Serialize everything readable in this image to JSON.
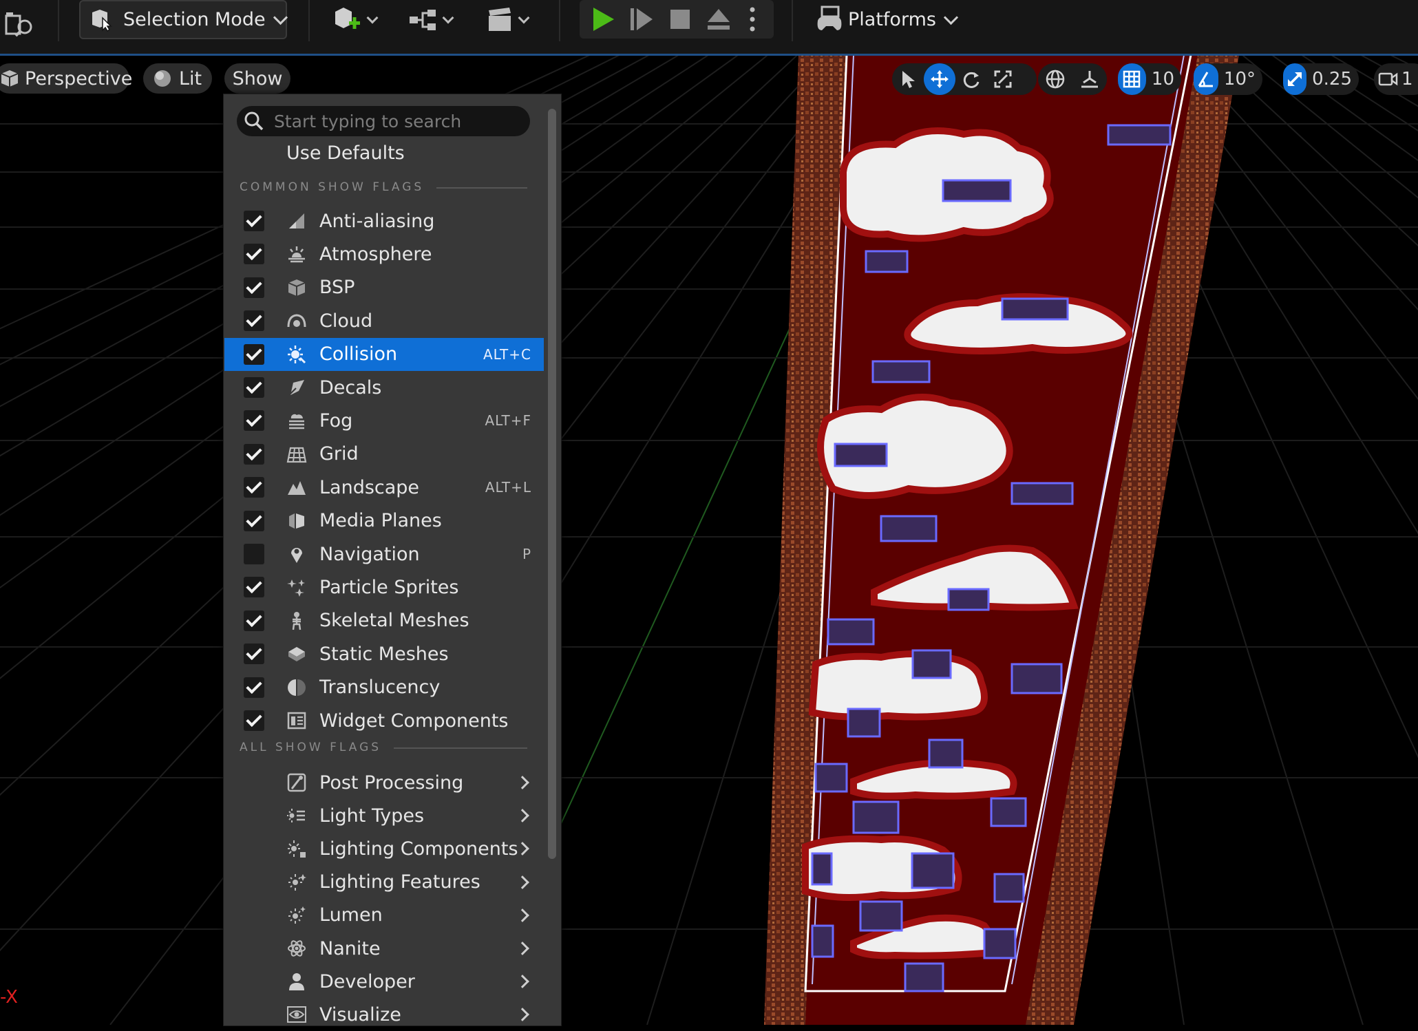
{
  "toolbar": {
    "selection_mode": "Selection Mode",
    "platforms": "Platforms"
  },
  "viewport": {
    "perspective": "Perspective",
    "lit": "Lit",
    "show": "Show",
    "grid_snap": "10",
    "rotation_snap": "10°",
    "scale_snap": "0.25",
    "camera_speed": "1",
    "axis_label": "-X"
  },
  "menu": {
    "search_placeholder": "Start typing to search",
    "use_defaults": "Use Defaults",
    "common_header": "COMMON SHOW FLAGS",
    "all_header": "ALL SHOW FLAGS",
    "common_flags": [
      {
        "label": "Anti-aliasing",
        "checked": true,
        "shortcut": "",
        "icon": "anti-aliasing-icon"
      },
      {
        "label": "Atmosphere",
        "checked": true,
        "shortcut": "",
        "icon": "atmosphere-icon"
      },
      {
        "label": "BSP",
        "checked": true,
        "shortcut": "",
        "icon": "bsp-icon"
      },
      {
        "label": "Cloud",
        "checked": true,
        "shortcut": "",
        "icon": "cloud-icon"
      },
      {
        "label": "Collision",
        "checked": true,
        "shortcut": "ALT+C",
        "icon": "collision-icon",
        "highlighted": true
      },
      {
        "label": "Decals",
        "checked": true,
        "shortcut": "",
        "icon": "decals-icon"
      },
      {
        "label": "Fog",
        "checked": true,
        "shortcut": "ALT+F",
        "icon": "fog-icon"
      },
      {
        "label": "Grid",
        "checked": true,
        "shortcut": "",
        "icon": "grid-icon"
      },
      {
        "label": "Landscape",
        "checked": true,
        "shortcut": "ALT+L",
        "icon": "landscape-icon"
      },
      {
        "label": "Media Planes",
        "checked": true,
        "shortcut": "",
        "icon": "media-planes-icon"
      },
      {
        "label": "Navigation",
        "checked": false,
        "shortcut": "P",
        "icon": "navigation-pin-icon"
      },
      {
        "label": "Particle Sprites",
        "checked": true,
        "shortcut": "",
        "icon": "particle-sprites-icon"
      },
      {
        "label": "Skeletal Meshes",
        "checked": true,
        "shortcut": "",
        "icon": "skeleton-icon"
      },
      {
        "label": "Static Meshes",
        "checked": true,
        "shortcut": "",
        "icon": "static-mesh-icon"
      },
      {
        "label": "Translucency",
        "checked": true,
        "shortcut": "",
        "icon": "translucency-icon"
      },
      {
        "label": "Widget Components",
        "checked": true,
        "shortcut": "",
        "icon": "widget-icon"
      }
    ],
    "all_flags": [
      {
        "label": "Post Processing",
        "icon": "post-processing-icon"
      },
      {
        "label": "Light Types",
        "icon": "light-types-icon"
      },
      {
        "label": "Lighting Components",
        "icon": "lighting-components-icon"
      },
      {
        "label": "Lighting Features",
        "icon": "lighting-features-icon"
      },
      {
        "label": "Lumen",
        "icon": "lumen-icon"
      },
      {
        "label": "Nanite",
        "icon": "nanite-atom-icon"
      },
      {
        "label": "Developer",
        "icon": "developer-person-icon"
      },
      {
        "label": "Visualize",
        "icon": "visualize-eye-icon"
      }
    ]
  },
  "colors": {
    "accent": "#0f6fd6",
    "play_green": "#4cbb17",
    "menu_bg": "#383838",
    "scene_red": "#5a0000"
  }
}
